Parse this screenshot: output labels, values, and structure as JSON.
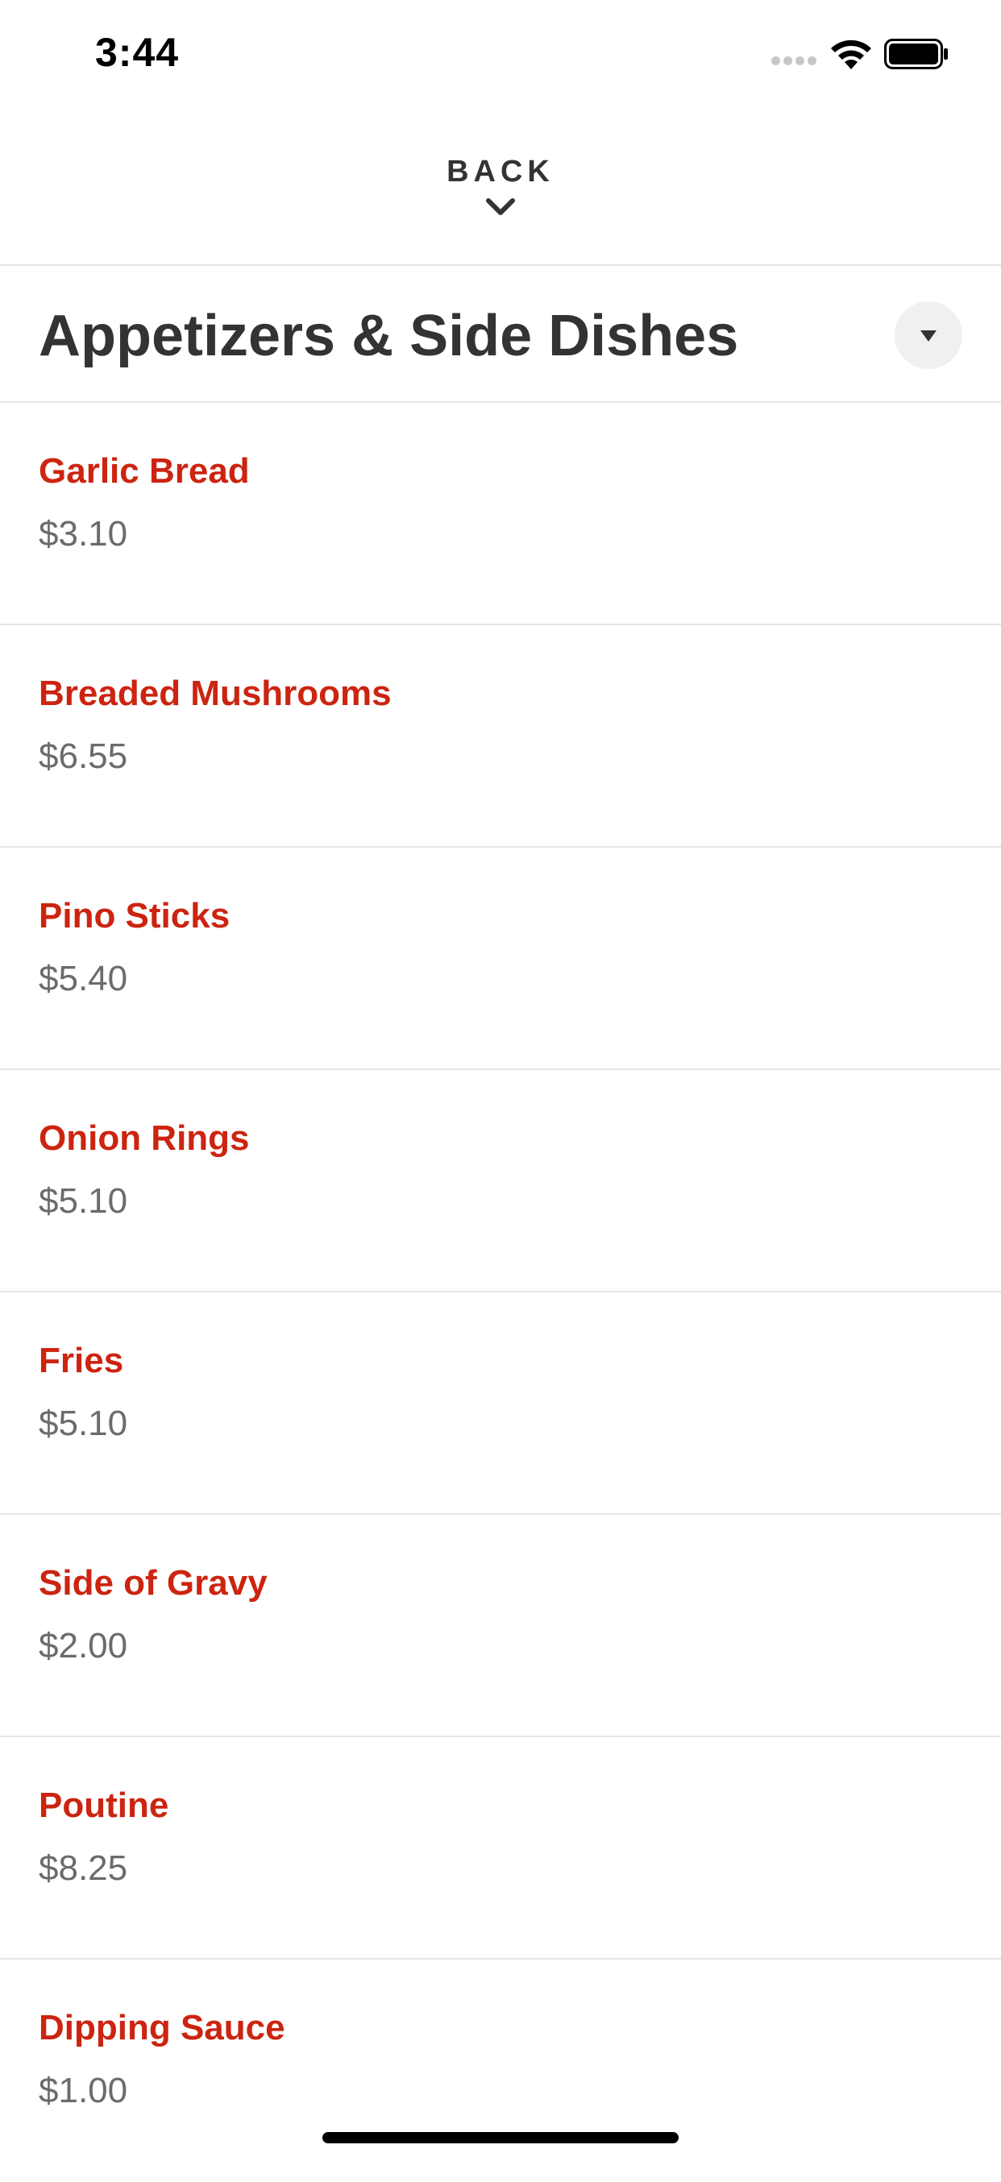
{
  "status_bar": {
    "time": "3:44"
  },
  "header": {
    "back_label": "BACK"
  },
  "section": {
    "title": "Appetizers & Side Dishes"
  },
  "colors": {
    "item_name": "#cc2410",
    "item_price": "#6b6b6b",
    "title": "#333333",
    "divider": "#e6e6e6"
  },
  "menu": {
    "items": [
      {
        "name": "Garlic Bread",
        "price": "$3.10"
      },
      {
        "name": "Breaded Mushrooms",
        "price": "$6.55"
      },
      {
        "name": "Pino Sticks",
        "price": "$5.40"
      },
      {
        "name": "Onion Rings",
        "price": "$5.10"
      },
      {
        "name": "Fries",
        "price": "$5.10"
      },
      {
        "name": "Side of Gravy",
        "price": "$2.00"
      },
      {
        "name": "Poutine",
        "price": "$8.25"
      },
      {
        "name": "Dipping Sauce",
        "price": "$1.00"
      }
    ]
  }
}
